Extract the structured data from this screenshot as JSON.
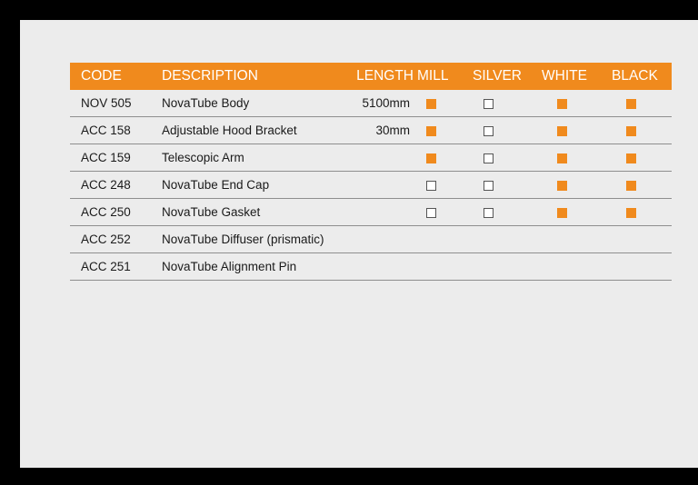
{
  "table": {
    "headers": {
      "code": "CODE",
      "description": "DESCRIPTION",
      "length": "LENGTH",
      "mill": "MILL",
      "silver": "SILVER",
      "white": "WHITE",
      "black": "BLACK"
    },
    "accent_color": "#f08a1d",
    "rows": [
      {
        "code": "NOV 505",
        "description": "NovaTube Body",
        "length": "5100mm",
        "mill": "filled",
        "silver": "empty",
        "white": "filled",
        "black": "filled"
      },
      {
        "code": "ACC 158",
        "description": "Adjustable Hood Bracket",
        "length": "30mm",
        "mill": "filled",
        "silver": "empty",
        "white": "filled",
        "black": "filled"
      },
      {
        "code": "ACC 159",
        "description": "Telescopic Arm",
        "length": "",
        "mill": "filled",
        "silver": "empty",
        "white": "filled",
        "black": "filled"
      },
      {
        "code": "ACC 248",
        "description": "NovaTube End Cap",
        "length": "",
        "mill": "empty",
        "silver": "empty",
        "white": "filled",
        "black": "filled"
      },
      {
        "code": "ACC 250",
        "description": "NovaTube Gasket",
        "length": "",
        "mill": "empty",
        "silver": "empty",
        "white": "filled",
        "black": "filled"
      },
      {
        "code": "ACC 252",
        "description": "NovaTube Diffuser (prismatic)",
        "length": "",
        "mill": "none",
        "silver": "none",
        "white": "none",
        "black": "none"
      },
      {
        "code": "ACC 251",
        "description": "NovaTube Alignment Pin",
        "length": "",
        "mill": "none",
        "silver": "none",
        "white": "none",
        "black": "none"
      }
    ]
  }
}
